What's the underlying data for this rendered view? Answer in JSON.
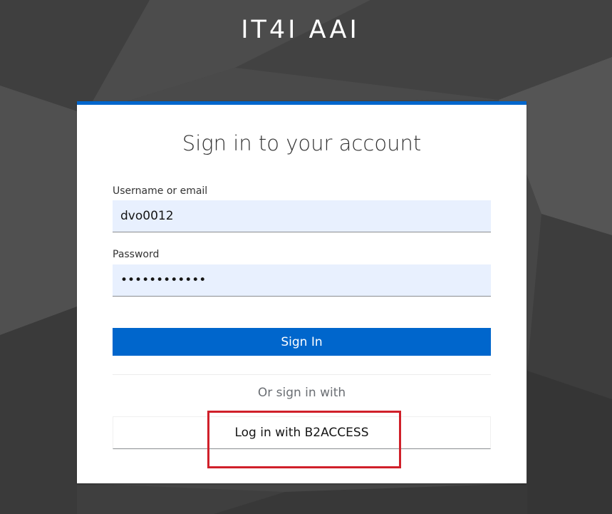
{
  "realm": {
    "title": "IT4I AAI"
  },
  "login_card": {
    "heading": "Sign in to your account",
    "accent_color": "#0066cc",
    "username": {
      "label": "Username or email",
      "value": "dvo0012"
    },
    "password": {
      "label": "Password",
      "value": "••••••••••••"
    },
    "submit_label": "Sign In",
    "social": {
      "separator_text": "Or sign in with",
      "providers": [
        {
          "label": "Log in with B2ACCESS"
        }
      ]
    }
  },
  "annotation": {
    "highlight_color": "#d0202a"
  }
}
